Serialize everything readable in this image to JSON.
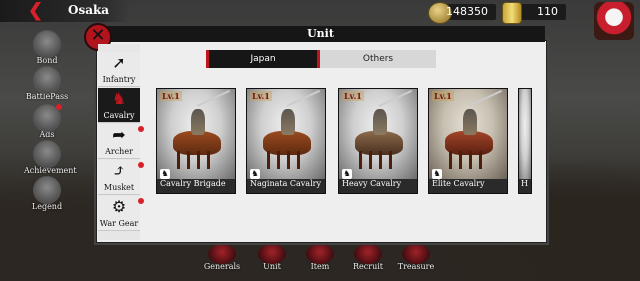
{
  "topbar": {
    "city": "Osaka",
    "coins": "148350",
    "gold": "110"
  },
  "sidebar": {
    "items": [
      {
        "label": "Bond",
        "icon": "bond-icon"
      },
      {
        "label": "BattlePass",
        "icon": "battlepass-icon"
      },
      {
        "label": "Ads",
        "icon": "ads-icon"
      },
      {
        "label": "Achievement",
        "icon": "trophy-icon"
      },
      {
        "label": "Legend",
        "icon": "legend-icon"
      }
    ]
  },
  "modal": {
    "title": "Unit",
    "tabs": [
      {
        "label": "Japan",
        "active": true
      },
      {
        "label": "Others",
        "active": false
      }
    ],
    "categories": [
      {
        "label": "Infantry",
        "icon": "spear-icon",
        "active": false,
        "alert": false
      },
      {
        "label": "Cavalry",
        "icon": "horse-icon",
        "active": true,
        "alert": false
      },
      {
        "label": "Archer",
        "icon": "bow-icon",
        "active": false,
        "alert": true
      },
      {
        "label": "Musket",
        "icon": "musket-icon",
        "active": false,
        "alert": true
      },
      {
        "label": "War Gear",
        "icon": "cannon-icon",
        "active": false,
        "alert": true
      }
    ],
    "units": [
      {
        "name": "Cavalry Brigade",
        "level": "Lv.1"
      },
      {
        "name": "Naginata Cavalry",
        "level": "Lv.1"
      },
      {
        "name": "Heavy Cavalry",
        "level": "Lv.1"
      },
      {
        "name": "Elite Cavalry",
        "level": "Lv.1"
      },
      {
        "name": "H",
        "level": ""
      }
    ]
  },
  "bottom_nav": [
    {
      "label": "Generals"
    },
    {
      "label": "Unit"
    },
    {
      "label": "Item"
    },
    {
      "label": "Recruit"
    },
    {
      "label": "Treasure"
    }
  ]
}
